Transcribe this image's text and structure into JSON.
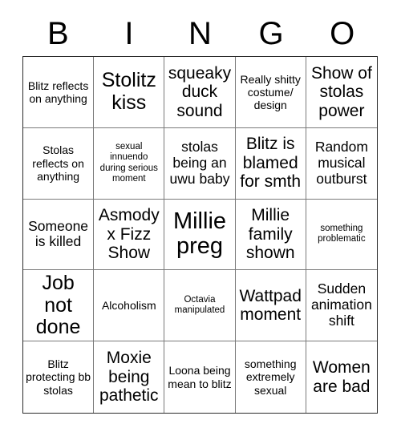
{
  "header": {
    "letters": [
      "B",
      "I",
      "N",
      "G",
      "O"
    ]
  },
  "grid": {
    "columns": 5,
    "rows": 5,
    "cells": [
      {
        "text": "Blitz reflects on anything",
        "size": "sm"
      },
      {
        "text": "Stolitz kiss",
        "size": "xl"
      },
      {
        "text": "squeaky duck sound",
        "size": "lg"
      },
      {
        "text": "Really shitty costume/ design",
        "size": "sm"
      },
      {
        "text": "Show of stolas power",
        "size": "lg"
      },
      {
        "text": "Stolas reflects on anything",
        "size": "sm"
      },
      {
        "text": "sexual innuendo during serious moment",
        "size": "xs"
      },
      {
        "text": "stolas being an uwu baby",
        "size": "md"
      },
      {
        "text": "Blitz is blamed for smth",
        "size": "lg"
      },
      {
        "text": "Random musical outburst",
        "size": "md"
      },
      {
        "text": "Someone is killed",
        "size": "md"
      },
      {
        "text": "Asmody x Fizz Show",
        "size": "lg"
      },
      {
        "text": "Millie preg",
        "size": "xxl"
      },
      {
        "text": "Millie family shown",
        "size": "lg"
      },
      {
        "text": "something problematic",
        "size": "xs"
      },
      {
        "text": "Job not done",
        "size": "xl"
      },
      {
        "text": "Alcoholism",
        "size": "sm"
      },
      {
        "text": "Octavia manipulated",
        "size": "xs"
      },
      {
        "text": "Wattpad moment",
        "size": "lg"
      },
      {
        "text": "Sudden animation shift",
        "size": "md"
      },
      {
        "text": "Blitz protecting bb stolas",
        "size": "sm"
      },
      {
        "text": "Moxie being pathetic",
        "size": "lg"
      },
      {
        "text": "Loona being mean to blitz",
        "size": "sm"
      },
      {
        "text": "something extremely sexual",
        "size": "sm"
      },
      {
        "text": "Women are bad",
        "size": "lg"
      }
    ]
  },
  "colors": {
    "background": "#ffffff",
    "text": "#000000",
    "inner_border": "#7a7a7a",
    "outer_border": "#2b2b2b"
  }
}
